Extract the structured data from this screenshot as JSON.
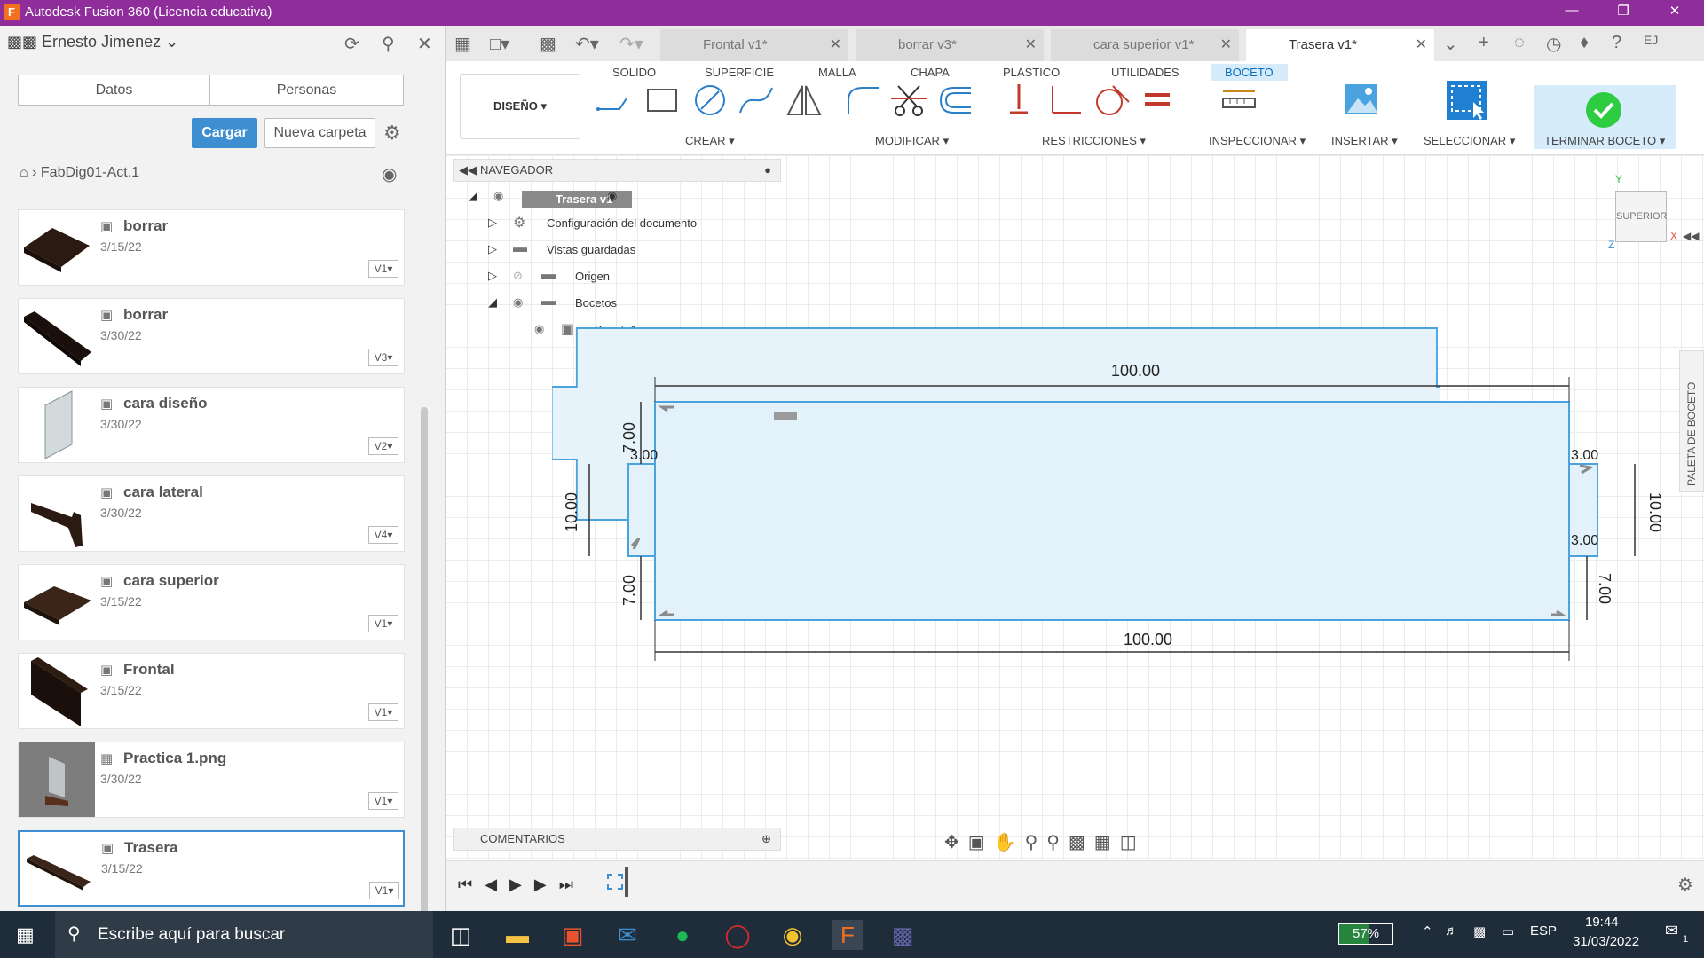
{
  "window": {
    "title": "Autodesk Fusion 360 (Licencia educativa)",
    "logo": "F"
  },
  "data_panel": {
    "user": "Ernesto Jimenez",
    "tabs": [
      "Datos",
      "Personas"
    ],
    "upload_label": "Cargar",
    "new_folder_label": "Nueva carpeta",
    "breadcrumb": "FabDig01-Act.1",
    "items": [
      {
        "name": "borrar",
        "date": "3/15/22",
        "version": "V1"
      },
      {
        "name": "borrar",
        "date": "3/30/22",
        "version": "V3"
      },
      {
        "name": "cara diseño",
        "date": "3/30/22",
        "version": "V2"
      },
      {
        "name": "cara lateral",
        "date": "3/30/22",
        "version": "V4"
      },
      {
        "name": "cara superior",
        "date": "3/15/22",
        "version": "V1"
      },
      {
        "name": "Frontal",
        "date": "3/15/22",
        "version": "V1"
      },
      {
        "name": "Practica 1.png",
        "date": "3/30/22",
        "version": "V1"
      },
      {
        "name": "Trasera",
        "date": "3/15/22",
        "version": "V1"
      }
    ]
  },
  "doc_tabs": [
    "Frontal v1*",
    "borrar v3*",
    "cara superior v1*",
    "Trasera v1*"
  ],
  "toolbar": {
    "workspace": "DISEÑO",
    "tabs": [
      "SOLIDO",
      "SUPERFICIE",
      "MALLA",
      "CHAPA",
      "PLÁSTICO",
      "UTILIDADES",
      "BOCETO"
    ],
    "groups": [
      "CREAR",
      "MODIFICAR",
      "RESTRICCIONES",
      "INSPECCIONAR",
      "INSERTAR",
      "SELECCIONAR",
      "TERMINAR BOCETO"
    ]
  },
  "browser": {
    "title": "NAVEGADOR",
    "root": "Trasera v1",
    "nodes": [
      "Configuración del documento",
      "Vistas guardadas",
      "Origen",
      "Bocetos",
      "Boceto1"
    ]
  },
  "comments_label": "COMENTARIOS",
  "viewcube_label": "SUPERIOR",
  "axes": {
    "x": "X",
    "y": "Y",
    "z": "Z"
  },
  "palette_label": "PALETA DE BOCETO",
  "dimensions": {
    "top": "100.00",
    "bottom": "100.00",
    "left_total": "10.00",
    "left_top": "7.00",
    "left_gap": "3.00",
    "left_bottom": "7.00",
    "right_total": "10.00",
    "right_gap_top": "3.00",
    "right_gap_bottom": "3.00",
    "right_bottom": "7.00"
  },
  "taskbar": {
    "search_placeholder": "Escribe aquí para buscar",
    "battery": "57%",
    "language": "ESP",
    "time": "19:44",
    "date": "31/03/2022",
    "notifications": "1"
  },
  "colors": {
    "titlebar": "#8f2d9b",
    "accent": "#3d8fd1",
    "sketch_fill": "#e6f3fb",
    "sketch_line": "#4aa3df",
    "finish_check": "#2ecc40"
  }
}
